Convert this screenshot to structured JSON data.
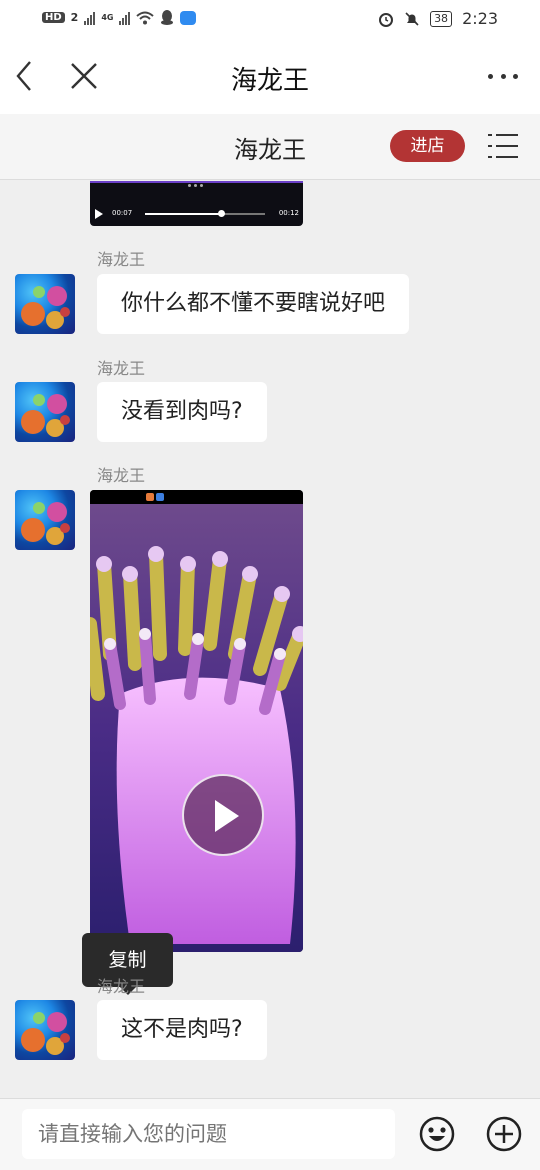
{
  "status_bar": {
    "hd_label": "HD",
    "hd_sim": "2",
    "net_label": "4G",
    "battery": "38",
    "time": "2:23"
  },
  "nav": {
    "title": "海龙王",
    "back_icon": "chevron-left-icon",
    "close_icon": "close-icon",
    "more_icon": "more-dots-icon"
  },
  "shop": {
    "name": "海龙王",
    "enter_label": "进店",
    "menu_icon": "list-menu-icon"
  },
  "video_top": {
    "time_current": "00:07",
    "time_total": "00:12",
    "progress": 0.64
  },
  "messages": [
    {
      "sender": "海龙王",
      "text": "你什么都不懂不要瞎说好吧"
    },
    {
      "sender": "海龙王",
      "text": "没看到肉吗?"
    },
    {
      "sender": "海龙王",
      "type": "video"
    },
    {
      "sender": "海龙王",
      "text": "这不是肉吗?"
    }
  ],
  "tooltip": {
    "label": "复制"
  },
  "input": {
    "placeholder": "请直接输入您的问题",
    "emoji_icon": "emoji-icon",
    "plus_icon": "plus-circle-icon"
  },
  "colors": {
    "enter_button": "#b33434",
    "background": "#efefef"
  }
}
